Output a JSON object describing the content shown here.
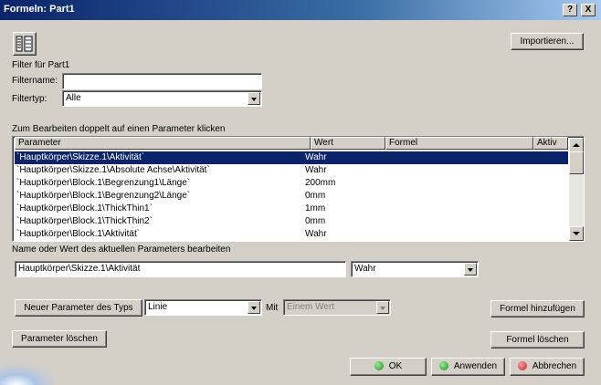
{
  "window": {
    "title": "Formeln: Part1",
    "help_label": "?",
    "close_label": "X"
  },
  "toolbar": {
    "import_label": "Importieren..."
  },
  "filter": {
    "heading": "Filter für Part1",
    "name_label": "Filtername:",
    "name_value": "",
    "type_label": "Filtertyp:",
    "type_value": "Alle"
  },
  "table": {
    "instruction": "Zum Bearbeiten doppelt auf einen Parameter klicken",
    "columns": [
      "Parameter",
      "Wert",
      "Formel",
      "Aktiv"
    ],
    "rows": [
      {
        "param": "`Hauptkörper\\Skizze.1\\Aktivität`",
        "value": "Wahr",
        "formula": "",
        "active": ""
      },
      {
        "param": "`Hauptkörper\\Skizze.1\\Absolute Achse\\Aktivität`",
        "value": "Wahr",
        "formula": "",
        "active": ""
      },
      {
        "param": "`Hauptkörper\\Block.1\\Begrenzung1\\Länge`",
        "value": "200mm",
        "formula": "",
        "active": ""
      },
      {
        "param": "`Hauptkörper\\Block.1\\Begrenzung2\\Länge`",
        "value": "0mm",
        "formula": "",
        "active": ""
      },
      {
        "param": "`Hauptkörper\\Block.1\\ThickThin1`",
        "value": "1mm",
        "formula": "",
        "active": ""
      },
      {
        "param": "`Hauptkörper\\Block.1\\ThickThin2`",
        "value": "0mm",
        "formula": "",
        "active": ""
      },
      {
        "param": "`Hauptkörper\\Block.1\\Aktivität`",
        "value": "Wahr",
        "formula": "",
        "active": ""
      }
    ]
  },
  "edit": {
    "label": "Name oder Wert des aktuellen Parameters bearbeiten",
    "name_value": "Hauptkörper\\Skizze.1\\Aktivität",
    "value_value": "Wahr"
  },
  "new_param": {
    "button_label": "Neuer Parameter des Typs",
    "type_value": "Linie",
    "with_label": "Mit",
    "with_value": "Einem Wert"
  },
  "buttons": {
    "add_formula": "Formel hinzufügen",
    "delete_param": "Parameter löschen",
    "delete_formula": "Formel löschen",
    "ok": "OK",
    "apply": "Anwenden",
    "cancel": "Abbrechen"
  },
  "colors": {
    "selection": "#0a246a",
    "ok_dot": "#1e8c1e",
    "apply_dot": "#1e8c1e",
    "cancel_dot": "#c81e1e"
  },
  "icons": {
    "filter_tool": "parameter-filter-icon"
  }
}
